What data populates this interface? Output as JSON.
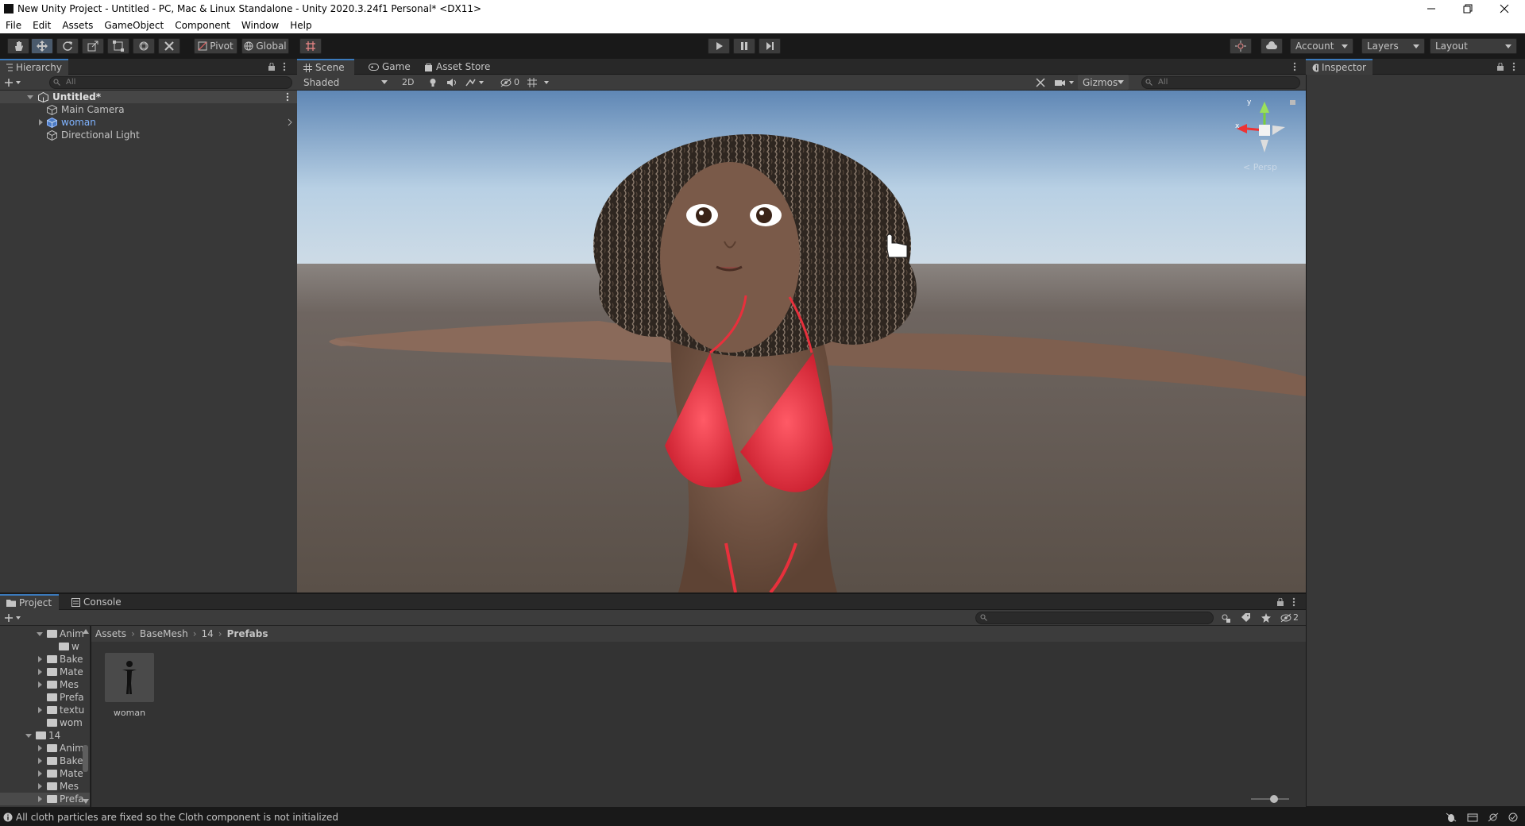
{
  "window": {
    "title": "New Unity Project - Untitled - PC, Mac & Linux Standalone - Unity 2020.3.24f1 Personal* <DX11>"
  },
  "menu": [
    "File",
    "Edit",
    "Assets",
    "GameObject",
    "Component",
    "Window",
    "Help"
  ],
  "toolbar": {
    "pivot_label": "Pivot",
    "global_label": "Global",
    "account_label": "Account",
    "layers_label": "Layers",
    "layout_label": "Layout"
  },
  "hierarchy": {
    "tab_label": "Hierarchy",
    "search_placeholder": "All",
    "scene_name": "Untitled*",
    "items": [
      {
        "label": "Main Camera"
      },
      {
        "label": "woman"
      },
      {
        "label": "Directional Light"
      }
    ]
  },
  "scene": {
    "tabs": [
      {
        "label": "Scene"
      },
      {
        "label": "Game"
      },
      {
        "label": "Asset Store"
      }
    ],
    "shading_mode": "Shaded",
    "mode_2d": "2D",
    "hidden_count": "0",
    "gizmos_label": "Gizmos",
    "search_placeholder": "All",
    "gizmo_x": "x",
    "gizmo_y": "y",
    "persp_label": "< Persp"
  },
  "inspector": {
    "tab_label": "Inspector"
  },
  "project": {
    "tabs": [
      {
        "label": "Project"
      },
      {
        "label": "Console"
      }
    ],
    "hidden_count": "2",
    "breadcrumb": [
      "Assets",
      "BaseMesh",
      "14",
      "Prefabs"
    ],
    "tree": [
      {
        "label": "Anim"
      },
      {
        "label": "w"
      },
      {
        "label": "Bake"
      },
      {
        "label": "Mate"
      },
      {
        "label": "Mes"
      },
      {
        "label": "Prefa"
      },
      {
        "label": "textu"
      },
      {
        "label": "wom"
      },
      {
        "label": "14"
      },
      {
        "label": "Anim"
      },
      {
        "label": "Bake"
      },
      {
        "label": "Mate"
      },
      {
        "label": "Mes"
      },
      {
        "label": "Prefa"
      }
    ],
    "assets": [
      {
        "label": "woman"
      }
    ]
  },
  "status": {
    "message": "All cloth particles are fixed so the Cloth component is not initialized"
  },
  "colors": {
    "accent": "#3a79bb",
    "panel": "#383838",
    "toolbar": "#191919",
    "prefab_blue": "#7fb3ff",
    "bikini": "#e8303c"
  }
}
